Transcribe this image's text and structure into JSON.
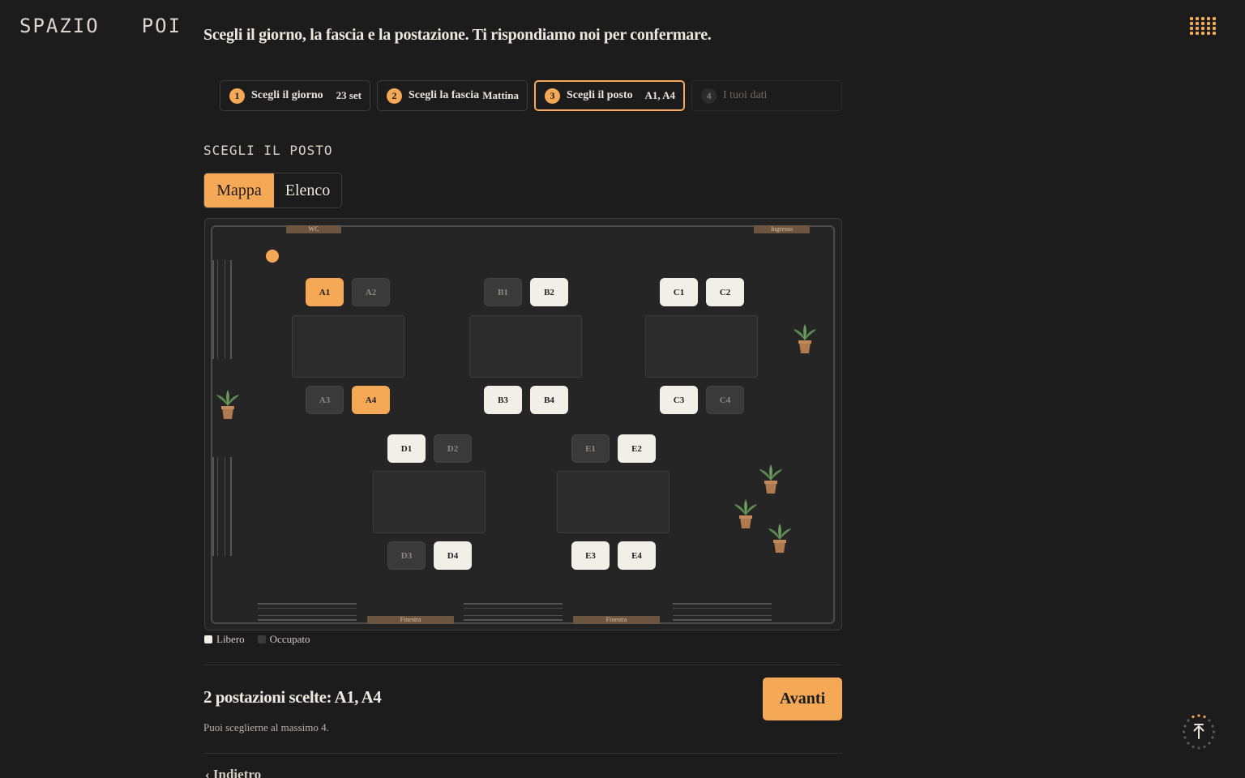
{
  "brand": {
    "part1": "SPAZIO",
    "part2": "POI"
  },
  "header": {
    "subtitle": "Scegli il giorno, la fascia e la postazione. Ti rispondiamo noi per confermare."
  },
  "steps": [
    {
      "num": "1",
      "label": "Scegli il giorno",
      "value": "23 set"
    },
    {
      "num": "2",
      "label": "Scegli la fascia",
      "value": "Mattina"
    },
    {
      "num": "3",
      "label": "Scegli il posto",
      "value": "A1, A4"
    },
    {
      "num": "4",
      "label": "I tuoi dati",
      "value": ""
    }
  ],
  "section_title": "SCEGLI IL POSTO",
  "view_toggle": {
    "map": "Mappa",
    "list": "Elenco",
    "active": "map"
  },
  "map": {
    "doors": {
      "wc": "WC",
      "entrance": "Ingresso",
      "window1": "Finestra",
      "window2": "Finestra"
    },
    "seats": {
      "A1": "selected",
      "A2": "busy",
      "A3": "busy",
      "A4": "selected",
      "B1": "busy",
      "B2": "free",
      "B3": "free",
      "B4": "free",
      "C1": "free",
      "C2": "free",
      "C3": "free",
      "C4": "busy",
      "D1": "free",
      "D2": "busy",
      "D3": "busy",
      "D4": "free",
      "E1": "busy",
      "E2": "free",
      "E3": "free",
      "E4": "free"
    }
  },
  "legend": {
    "free": "Libero",
    "busy": "Occupato"
  },
  "summary": {
    "text": "2 postazioni scelte: A1, A4",
    "hint": "Puoi sceglierne al massimo 4."
  },
  "actions": {
    "next": "Avanti",
    "back": "‹ Indietro"
  },
  "colors": {
    "accent": "#f5a855",
    "background": "#1c1c1c",
    "seat_free": "#f2efe9",
    "seat_busy": "#3a3a3a"
  }
}
